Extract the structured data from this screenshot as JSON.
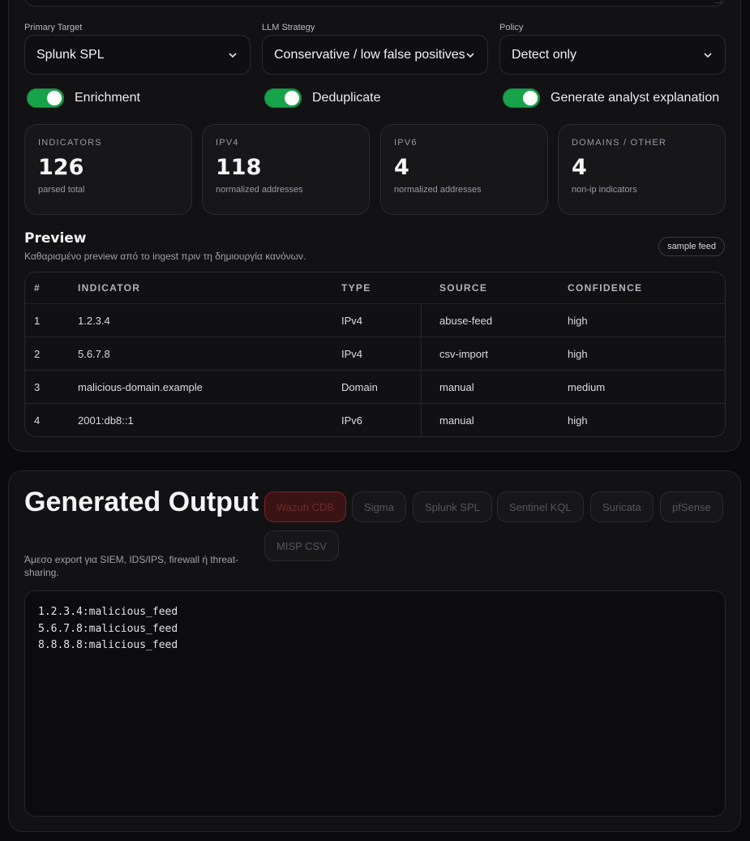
{
  "config": {
    "fields": [
      {
        "label": "Primary Target",
        "value": "Splunk SPL"
      },
      {
        "label": "LLM Strategy",
        "value": "Conservative / low false positives"
      },
      {
        "label": "Policy",
        "value": "Detect only"
      }
    ],
    "toggles": [
      {
        "label": "Enrichment",
        "on": true
      },
      {
        "label": "Deduplicate",
        "on": true
      },
      {
        "label": "Generate analyst explanation",
        "on": true
      }
    ]
  },
  "stats": [
    {
      "title": "INDICATORS",
      "value": "126",
      "sub": "parsed total"
    },
    {
      "title": "IPV4",
      "value": "118",
      "sub": "normalized addresses"
    },
    {
      "title": "IPV6",
      "value": "4",
      "sub": "normalized addresses"
    },
    {
      "title": "DOMAINS / OTHER",
      "value": "4",
      "sub": "non-ip indicators"
    }
  ],
  "preview": {
    "title": "Preview",
    "subtitle": "Καθαρισμένο preview από το ingest πριν τη δημιουργία κανόνων.",
    "badge": "sample feed",
    "columns": [
      "#",
      "INDICATOR",
      "TYPE",
      "SOURCE",
      "CONFIDENCE"
    ],
    "rows": [
      [
        "1",
        "1.2.3.4",
        "IPv4",
        "abuse-feed",
        "high"
      ],
      [
        "2",
        "5.6.7.8",
        "IPv4",
        "csv-import",
        "high"
      ],
      [
        "3",
        "malicious-domain.example",
        "Domain",
        "manual",
        "medium"
      ],
      [
        "4",
        "2001:db8::1",
        "IPv6",
        "manual",
        "high"
      ]
    ]
  },
  "output": {
    "title": "Generated Output",
    "subtitle": "Άμεσο export για SIEM, IDS/IPS, firewall ή threat-sharing.",
    "formats": [
      "Wazuh CDB",
      "Sigma",
      "Splunk SPL",
      "Sentinel KQL",
      "Suricata",
      "pfSense",
      "MISP CSV"
    ],
    "active_format": "Wazuh CDB",
    "code": "1.2.3.4:malicious_feed\n5.6.7.8:malicious_feed\n8.8.8.8:malicious_feed"
  },
  "colors": {
    "accent_green": "#16a34a",
    "active_red": "#3a1414"
  }
}
